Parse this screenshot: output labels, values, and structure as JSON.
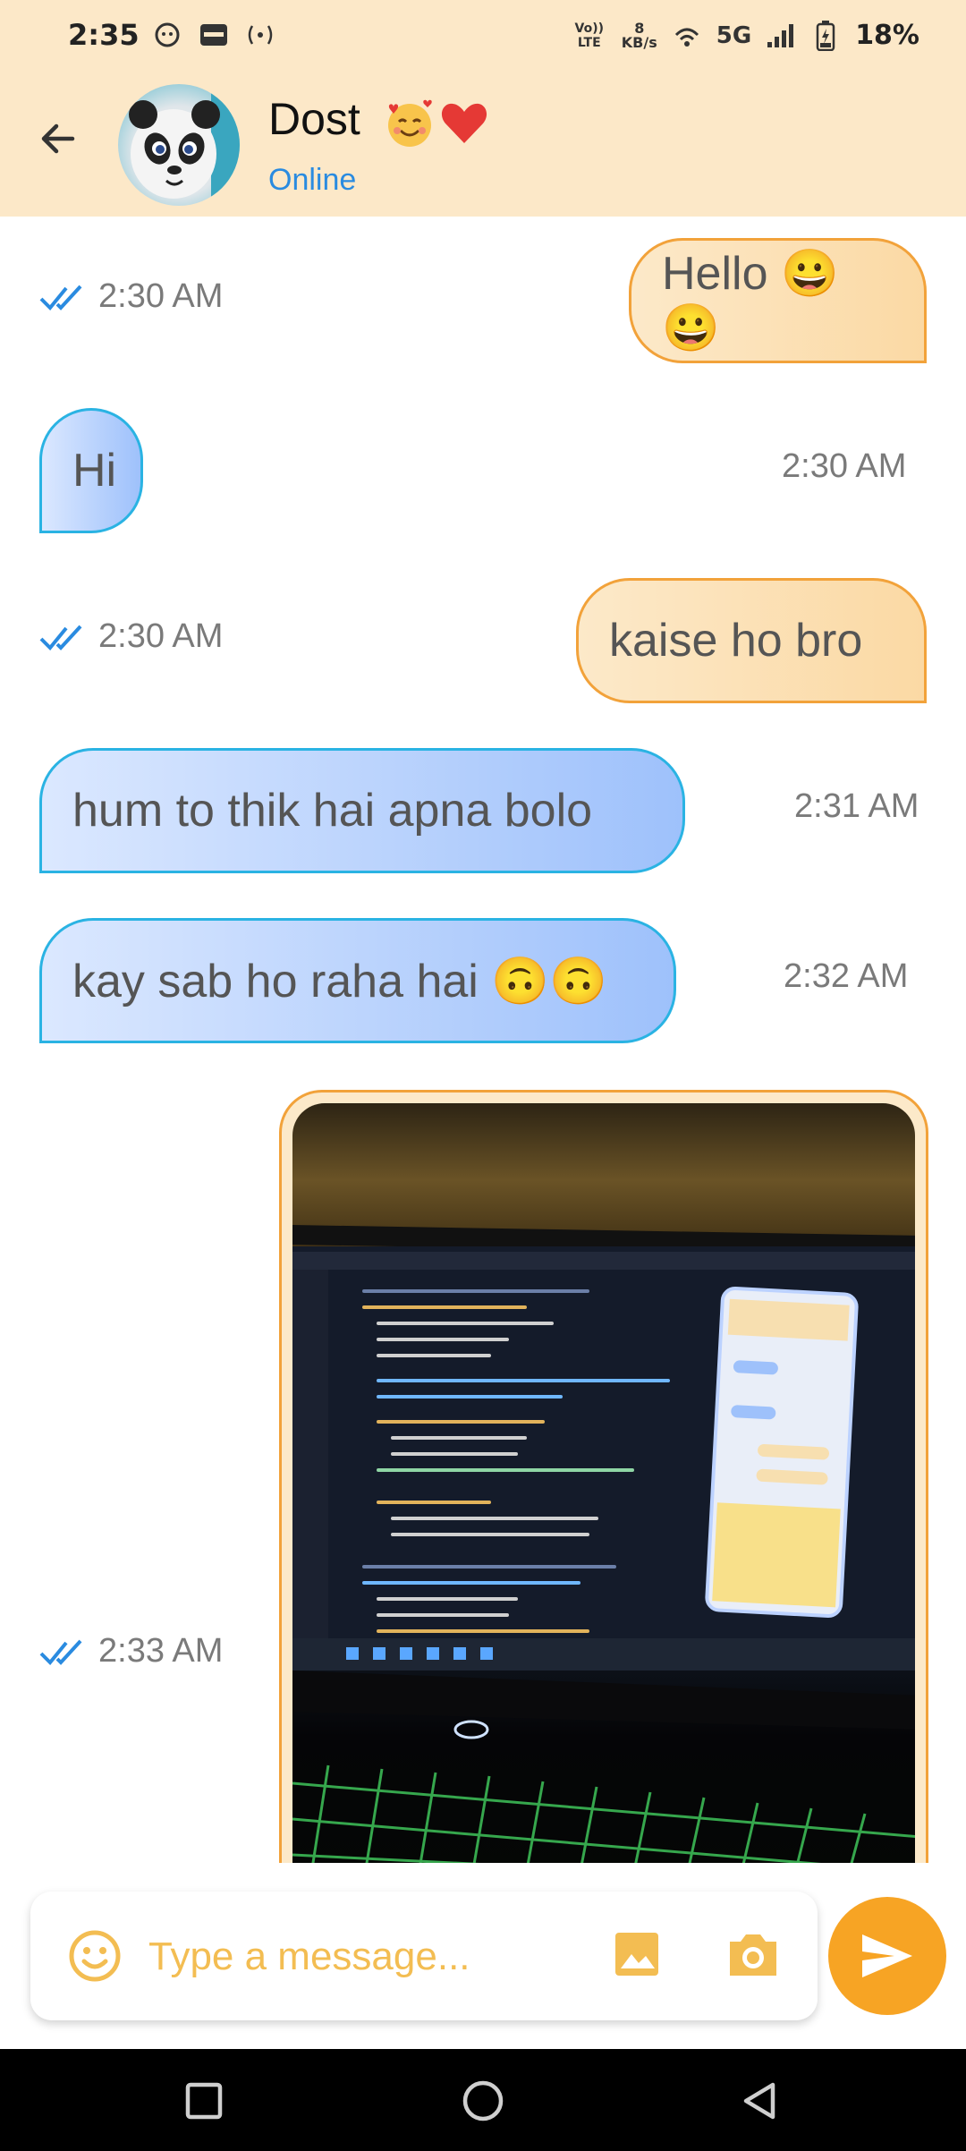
{
  "status_bar": {
    "time": "2:35",
    "volte": "Vo)) LTE",
    "speed_value": "8",
    "speed_unit": "KB/s",
    "network": "5G",
    "battery": "18%"
  },
  "header": {
    "contact_name": "Dost",
    "contact_status": "Online",
    "icons": [
      "back-arrow-icon",
      "smiling-face-with-hearts-emoji",
      "red-heart-emoji"
    ]
  },
  "messages": [
    {
      "direction": "outgoing",
      "text": "Hello 😀😀",
      "time": "2:30 AM",
      "read": true
    },
    {
      "direction": "incoming",
      "text": "Hi",
      "time": "2:30 AM"
    },
    {
      "direction": "outgoing",
      "text": "kaise ho bro",
      "time": "2:30 AM",
      "read": true
    },
    {
      "direction": "incoming",
      "text": "hum to thik hai apna bolo",
      "time": "2:31 AM"
    },
    {
      "direction": "incoming",
      "text": "kay sab ho raha hai 🙃🙃",
      "time": "2:32 AM"
    },
    {
      "direction": "outgoing",
      "type": "image",
      "time": "2:33 AM",
      "read": true
    }
  ],
  "composer": {
    "placeholder": "Type a message...",
    "icons": [
      "emoji-icon",
      "gallery-icon",
      "camera-icon",
      "send-icon"
    ]
  },
  "colors": {
    "header_bg": "#fce8c8",
    "outgoing_border": "#f2a23a",
    "incoming_border": "#2ab3e3",
    "online_text": "#2a8be0",
    "read_tick": "#2a8be0",
    "send_button": "#f7a424",
    "composer_icon": "#f3bd52"
  }
}
